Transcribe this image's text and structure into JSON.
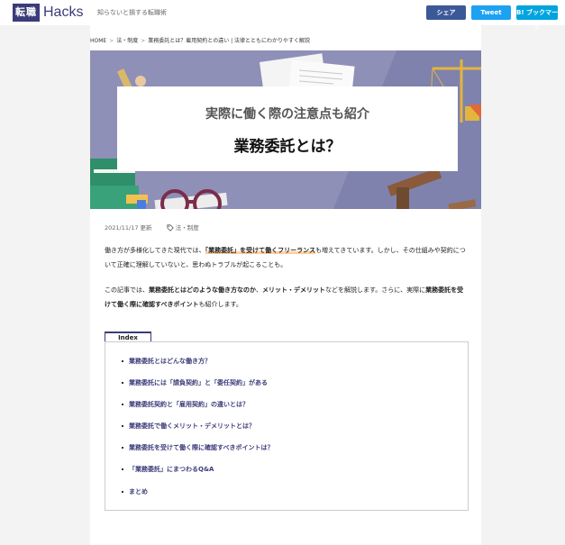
{
  "header": {
    "logo_box": "転職",
    "logo_text": "Hacks",
    "tagline": "知らないと損する転職術",
    "share_facebook": "シェア",
    "share_twitter": "Tweet",
    "share_hatena": "B! ブックマーク"
  },
  "breadcrumb": {
    "home": "HOME",
    "category": "法・制度",
    "current": "業務委託とは？雇用契約との違い | 法律とともにわかりやすく解説"
  },
  "hero": {
    "subtitle": "実際に働く際の注意点も紹介",
    "title": "業務委託とは？"
  },
  "meta": {
    "date": "2021/11/17 更新",
    "tag": "法・制度"
  },
  "intro": {
    "p1_a": "働き方が多様化してきた現代では、",
    "p1_hl": "「業務委託」を受けて働くフリーランス",
    "p1_b": "も増えてきています。しかし、その仕組みや契約について正確に理解していないと、思わぬトラブルが起こることも。",
    "p2_a": "この記事では、",
    "p2_b1": "業務委託とはどのような働き方なのか",
    "p2_c": "、",
    "p2_b2": "メリット・デメリット",
    "p2_d": "などを解説します。さらに、実際に",
    "p2_b3": "業務委託を受けて働く際に確認すべきポイント",
    "p2_e": "も紹介します。"
  },
  "index": {
    "label": "Index",
    "items": [
      "業務委託とはどんな働き方？",
      "業務委託には「請負契約」と「委任契約」がある",
      "業務委託契約と「雇用契約」の違いとは？",
      "業務委託で働くメリット・デメリットとは？",
      "業務委託を受けて働く際に確認すべきポイントは？",
      "「業務委託」にまつわるQ&A",
      "まとめ"
    ]
  },
  "colors": {
    "brand": "#3b3b7a",
    "accent": "#f39800",
    "hero_bg": "#8e90b8"
  }
}
